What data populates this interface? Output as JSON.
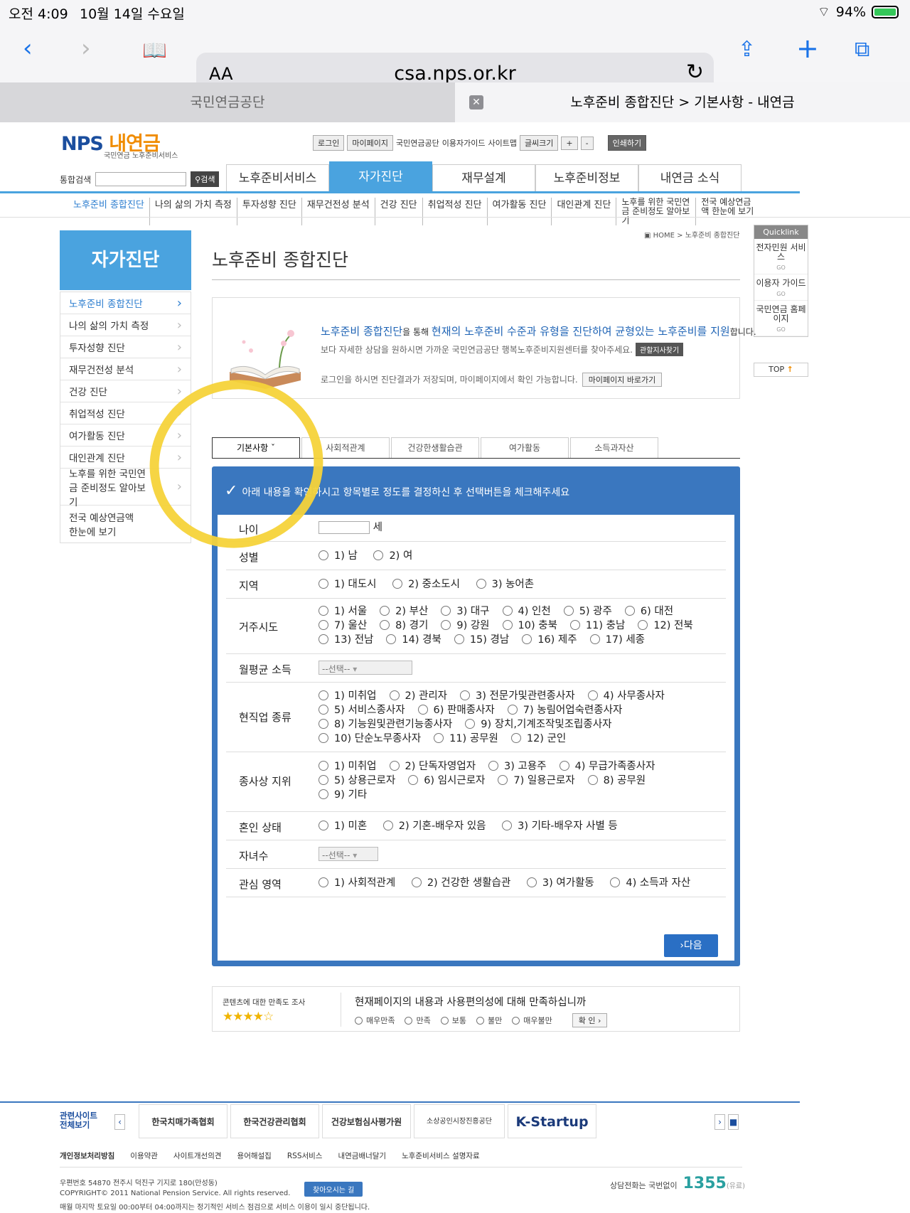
{
  "status": {
    "time": "오전 4:09",
    "date": "10월 14일 수요일",
    "battery": "94%"
  },
  "browser": {
    "aa": "AA",
    "url": "csa.nps.or.kr",
    "tab1": "국민연금공단",
    "tab2": "노후준비 종합진단 > 기본사항 - 내연금"
  },
  "site": {
    "logo_main": "NPS",
    "logo_sub": "내연금",
    "logo_caption": "국민연금 노후준비서비스",
    "util": [
      "로그인",
      "마이페이지",
      "국민연금공단",
      "이용자가이드",
      "사이트맵",
      "글씨크기",
      "+",
      "-",
      "인쇄하기"
    ],
    "search_label": "통합검색",
    "search_btn": "검색",
    "gnb": [
      "노후준비서비스",
      "자가진단",
      "재무설계",
      "노후준비정보",
      "내연금 소식"
    ],
    "subnav": [
      "노후준비 종합진단",
      "나의 삶의 가치 측정",
      "투자성향 진단",
      "재무건전성 분석",
      "건강 진단",
      "취업적성 진단",
      "여가활동 진단",
      "대인관계 진단",
      "노후를 위한 국민연금 준비정도 알아보기",
      "전국 예상연금액 한눈에 보기"
    ],
    "lnb_title": "자가진단",
    "lnb": [
      "노후준비 종합진단",
      "나의 삶의 가치 측정",
      "투자성향 진단",
      "재무건전성 분석",
      "건강 진단",
      "취업적성 진단",
      "여가활동 진단",
      "대인관계 진단",
      "노후를 위한 국민연금 준비정도 알아보기",
      "전국 예상연금액 한눈에 보기"
    ],
    "page_title": "노후준비 종합진단",
    "breadcrumb": "HOME > 노후준비 종합진단",
    "quick": {
      "title": "Quicklink",
      "items": [
        "전자민원 서비스",
        "이용자 가이드",
        "국민연금 홈페이지"
      ],
      "go": "GO",
      "top": "TOP"
    },
    "intro": {
      "l1a": "노후준비 종합진단",
      "l1b": "을 통해 ",
      "l1c": "현재의 노후준비 수준과 유형을 진단하여 균형있는 노후준비를 지원",
      "l1d": "합니다.",
      "l2": "보다 자세한 상담을 원하시면 가까운 국민연금공단 행복노후준비지원센터를 찾아주세요.",
      "l2btn": "관할지사찾기",
      "l3": "로그인을 하시면 진단결과가 저장되며, 마이페이지에서 확인 가능합니다.",
      "l3btn": "마이페이지 바로가기"
    },
    "tabs": [
      "기본사항",
      "사회적관계",
      "건강한생활습관",
      "여가활동",
      "소득과자산"
    ],
    "guide": "아래 내용을 확인하시고 항목별로 정도를 결정하신 후 선택버튼을 체크해주세요",
    "form": {
      "age_label": "나이",
      "age_unit": "세",
      "gender_label": "성별",
      "gender": [
        "1) 남",
        "2) 여"
      ],
      "region_label": "지역",
      "region": [
        "1) 대도시",
        "2) 중소도시",
        "3) 농어촌"
      ],
      "city_label": "거주시도",
      "city": [
        "1) 서울",
        "2) 부산",
        "3) 대구",
        "4) 인천",
        "5) 광주",
        "6) 대전",
        "7) 울산",
        "8) 경기",
        "9) 강원",
        "10) 충북",
        "11) 충남",
        "12) 전북",
        "13) 전남",
        "14) 경북",
        "15) 경남",
        "16) 제주",
        "17) 세종"
      ],
      "income_label": "월평균 소득",
      "income_select": "--선택--",
      "job_label": "현직업 종류",
      "job": [
        "1) 미취업",
        "2) 관리자",
        "3) 전문가및관련종사자",
        "4) 사무종사자",
        "5) 서비스종사자",
        "6) 판매종사자",
        "7) 농림어업숙련종사자",
        "8) 기능원및관련기능종사자",
        "9) 장치,기계조작및조립종사자",
        "10) 단순노무종사자",
        "11) 공무원",
        "12) 군인"
      ],
      "status_label": "종사상 지위",
      "status": [
        "1) 미취업",
        "2) 단독자영업자",
        "3) 고용주",
        "4) 무급가족종사자",
        "5) 상용근로자",
        "6) 임시근로자",
        "7) 일용근로자",
        "8) 공무원",
        "9) 기타"
      ],
      "marital_label": "혼인 상태",
      "marital": [
        "1) 미혼",
        "2) 기혼-배우자 있음",
        "3) 기타-배우자 사별 등"
      ],
      "children_label": "자녀수",
      "children_select": "--선택--",
      "interest_label": "관심 영역",
      "interest": [
        "1) 사회적관계",
        "2) 건강한 생활습관",
        "3) 여가활동",
        "4) 소득과 자산"
      ],
      "next": "다음"
    },
    "survey": {
      "title": "콘텐츠에 대한 만족도 조사",
      "stars": "★★★★☆",
      "question": "현재페이지의 내용과 사용편의성에 대해 만족하십니까",
      "options": [
        "매우만족",
        "만족",
        "보통",
        "불만",
        "매우불만"
      ],
      "confirm": "확 인"
    },
    "footer": {
      "related": "관련사이트 전체보기",
      "banners": [
        "한국치매가족협회",
        "한국건강관리협회",
        "건강보험심사평가원",
        "소상공인시장진흥공단",
        "K-Startup"
      ],
      "links": [
        "개인정보처리방침",
        "이용약관",
        "사이트개선의견",
        "용어해설집",
        "RSS서비스",
        "내연금배너달기",
        "노후준비서비스 설명자료"
      ],
      "addr1": "우편번호 54870  전주시 덕진구 기지로 180(만성동)",
      "addr2": "COPYRIGHT© 2011 National Pension Service. All rights reserved.",
      "addr3": "매월 마지막 토요일 00:00부터 04:00까지는 정기적인 서비스 점검으로 서비스 이용이 일시 중단됩니다.",
      "find": "찾아오시는 길",
      "tel_label": "상담전화는 국번없이",
      "tel": "1355",
      "tel_note": "(유료)"
    }
  }
}
